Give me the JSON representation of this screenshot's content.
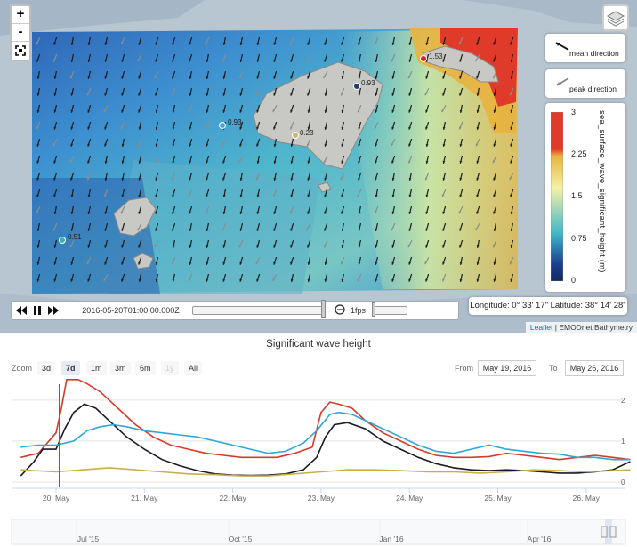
{
  "map": {
    "zoom_in_label": "+",
    "zoom_out_label": "-",
    "fullscreen_icon": "fullscreen-icon",
    "layers_icon": "layers-icon",
    "legend_mean": "mean direction",
    "legend_peak": "peak direction",
    "colorbar": {
      "title": "sea_surface_wave_significant_height (m)",
      "ticks": [
        "3",
        "2,25",
        "1,5",
        "0,75",
        "0"
      ],
      "colors": [
        "#e03a2a",
        "#e8b33f",
        "#f4f1a7",
        "#3fb6c8",
        "#1c3f8f",
        "#102a5a"
      ]
    },
    "coordinates": "Longitude: 0° 33' 17\" Latitude: 38° 14' 28\"",
    "attribution_leaflet": "Leaflet",
    "attribution_rest": " | EMODnet Bathymetry",
    "stations": [
      {
        "label": "0.93",
        "color": "#5b9bd5"
      },
      {
        "label": "0.93",
        "color": "#1f3b70"
      },
      {
        "label": "0.23",
        "color": "#c8b870"
      },
      {
        "label": "1.53",
        "color": "#e02020"
      },
      {
        "label": "0.51",
        "color": "#3bb3b3"
      }
    ],
    "time_control": {
      "date": "2016-05-20T01:00:00.000Z",
      "speed": "1fps",
      "back_icon": "step-backward-icon",
      "pause_icon": "pause-icon",
      "forward_icon": "step-forward-icon",
      "speed_icon": "speed-icon"
    }
  },
  "chart": {
    "title": "Significant wave height",
    "zoom_label": "Zoom",
    "range_buttons": [
      "3d",
      "7d",
      "1m",
      "3m",
      "6m",
      "1y",
      "All"
    ],
    "from_label": "From",
    "from_value": "May 19, 2016",
    "to_label": "To",
    "to_value": "May 26, 2016",
    "navigator_labels": [
      "Jul '15",
      "Oct '15",
      "Jan '16",
      "Apr '16"
    ]
  },
  "chart_data": {
    "type": "line",
    "title": "Significant wave height",
    "x": [
      "20. May",
      "21. May",
      "22. May",
      "23. May",
      "24. May",
      "25. May",
      "26. May"
    ],
    "ylim": [
      0,
      2.3
    ],
    "y_ticks": [
      "2",
      "1",
      "0"
    ],
    "grid": true,
    "series": [
      {
        "color": "#d43a2a",
        "points": [
          [
            -0.4,
            0.6
          ],
          [
            -0.2,
            0.7
          ],
          [
            0.0,
            1.2
          ],
          [
            0.06,
            1.8
          ],
          [
            0.12,
            2.5
          ],
          [
            0.25,
            2.5
          ],
          [
            0.35,
            2.4
          ],
          [
            0.5,
            2.2
          ],
          [
            0.7,
            1.8
          ],
          [
            0.9,
            1.4
          ],
          [
            1.1,
            1.1
          ],
          [
            1.3,
            0.9
          ],
          [
            1.5,
            0.8
          ],
          [
            1.7,
            0.7
          ],
          [
            1.9,
            0.65
          ],
          [
            2.1,
            0.6
          ],
          [
            2.3,
            0.6
          ],
          [
            2.5,
            0.6
          ],
          [
            2.7,
            0.7
          ],
          [
            2.9,
            0.85
          ],
          [
            3.0,
            1.7
          ],
          [
            3.1,
            1.95
          ],
          [
            3.2,
            1.9
          ],
          [
            3.35,
            1.8
          ],
          [
            3.5,
            1.5
          ],
          [
            3.7,
            1.2
          ],
          [
            3.9,
            1.0
          ],
          [
            4.1,
            0.8
          ],
          [
            4.3,
            0.65
          ],
          [
            4.5,
            0.6
          ],
          [
            4.7,
            0.6
          ],
          [
            4.9,
            0.62
          ],
          [
            5.1,
            0.7
          ],
          [
            5.3,
            0.65
          ],
          [
            5.5,
            0.6
          ],
          [
            5.7,
            0.55
          ],
          [
            5.9,
            0.6
          ],
          [
            6.1,
            0.65
          ],
          [
            6.3,
            0.6
          ],
          [
            6.5,
            0.55
          ]
        ]
      },
      {
        "color": "#1a1a2a",
        "points": [
          [
            -0.4,
            0.15
          ],
          [
            -0.25,
            0.5
          ],
          [
            -0.15,
            0.8
          ],
          [
            0.0,
            0.8
          ],
          [
            0.1,
            1.3
          ],
          [
            0.2,
            1.7
          ],
          [
            0.32,
            1.9
          ],
          [
            0.45,
            1.8
          ],
          [
            0.6,
            1.5
          ],
          [
            0.8,
            1.1
          ],
          [
            1.0,
            0.8
          ],
          [
            1.2,
            0.55
          ],
          [
            1.4,
            0.4
          ],
          [
            1.6,
            0.28
          ],
          [
            1.8,
            0.2
          ],
          [
            2.0,
            0.17
          ],
          [
            2.2,
            0.16
          ],
          [
            2.4,
            0.17
          ],
          [
            2.6,
            0.2
          ],
          [
            2.8,
            0.3
          ],
          [
            2.95,
            0.6
          ],
          [
            3.05,
            1.1
          ],
          [
            3.15,
            1.4
          ],
          [
            3.3,
            1.45
          ],
          [
            3.5,
            1.3
          ],
          [
            3.7,
            1.0
          ],
          [
            3.9,
            0.8
          ],
          [
            4.1,
            0.6
          ],
          [
            4.3,
            0.45
          ],
          [
            4.5,
            0.35
          ],
          [
            4.7,
            0.3
          ],
          [
            4.9,
            0.28
          ],
          [
            5.1,
            0.3
          ],
          [
            5.3,
            0.28
          ],
          [
            5.5,
            0.25
          ],
          [
            5.7,
            0.22
          ],
          [
            5.9,
            0.22
          ],
          [
            6.1,
            0.25
          ],
          [
            6.3,
            0.3
          ],
          [
            6.5,
            0.5
          ]
        ]
      },
      {
        "color": "#2ea6d6",
        "points": [
          [
            -0.4,
            0.85
          ],
          [
            -0.2,
            0.9
          ],
          [
            0.0,
            0.9
          ],
          [
            0.2,
            1.0
          ],
          [
            0.35,
            1.25
          ],
          [
            0.5,
            1.35
          ],
          [
            0.65,
            1.4
          ],
          [
            0.8,
            1.35
          ],
          [
            1.0,
            1.25
          ],
          [
            1.2,
            1.2
          ],
          [
            1.4,
            1.15
          ],
          [
            1.6,
            1.1
          ],
          [
            1.8,
            1.0
          ],
          [
            2.0,
            0.9
          ],
          [
            2.2,
            0.8
          ],
          [
            2.4,
            0.7
          ],
          [
            2.6,
            0.75
          ],
          [
            2.8,
            0.95
          ],
          [
            2.95,
            1.25
          ],
          [
            3.1,
            1.65
          ],
          [
            3.2,
            1.7
          ],
          [
            3.35,
            1.65
          ],
          [
            3.5,
            1.5
          ],
          [
            3.7,
            1.3
          ],
          [
            3.9,
            1.1
          ],
          [
            4.1,
            0.9
          ],
          [
            4.3,
            0.75
          ],
          [
            4.5,
            0.7
          ],
          [
            4.7,
            0.8
          ],
          [
            4.9,
            0.9
          ],
          [
            5.1,
            0.8
          ],
          [
            5.3,
            0.75
          ],
          [
            5.5,
            0.7
          ],
          [
            5.7,
            0.68
          ],
          [
            5.9,
            0.6
          ],
          [
            6.1,
            0.6
          ],
          [
            6.3,
            0.55
          ],
          [
            6.5,
            0.55
          ]
        ]
      },
      {
        "color": "#c8b048",
        "points": [
          [
            -0.4,
            0.3
          ],
          [
            0.0,
            0.25
          ],
          [
            0.3,
            0.3
          ],
          [
            0.6,
            0.35
          ],
          [
            0.9,
            0.3
          ],
          [
            1.2,
            0.25
          ],
          [
            1.5,
            0.2
          ],
          [
            1.8,
            0.18
          ],
          [
            2.1,
            0.15
          ],
          [
            2.4,
            0.15
          ],
          [
            2.7,
            0.2
          ],
          [
            3.0,
            0.25
          ],
          [
            3.3,
            0.3
          ],
          [
            3.6,
            0.3
          ],
          [
            3.9,
            0.28
          ],
          [
            4.2,
            0.25
          ],
          [
            4.5,
            0.25
          ],
          [
            4.8,
            0.22
          ],
          [
            5.1,
            0.25
          ],
          [
            5.4,
            0.3
          ],
          [
            5.7,
            0.28
          ],
          [
            6.0,
            0.25
          ],
          [
            6.3,
            0.28
          ],
          [
            6.5,
            0.3
          ]
        ]
      }
    ]
  }
}
